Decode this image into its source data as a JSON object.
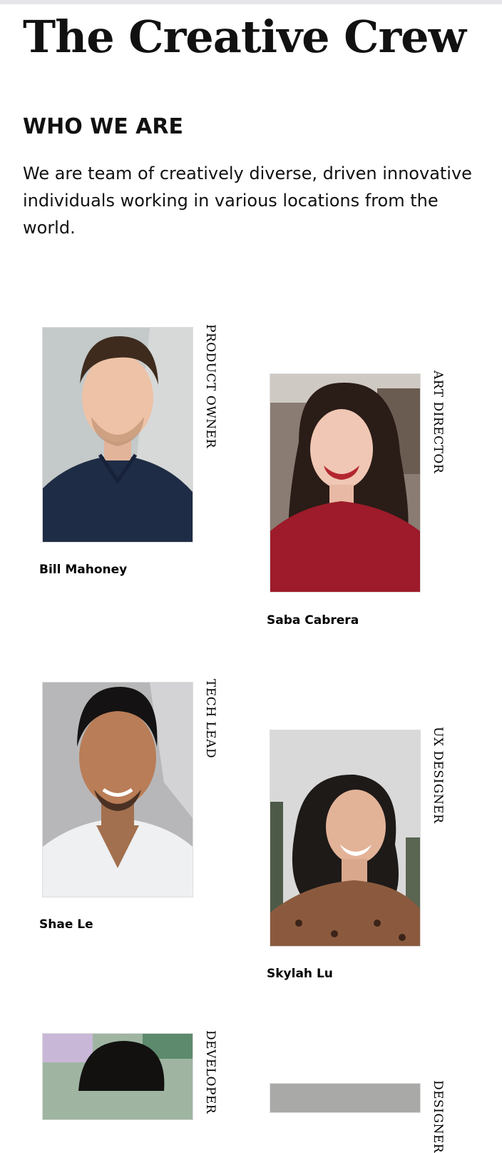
{
  "site": {
    "title": "The Creative Crew"
  },
  "about": {
    "heading": "WHO WE ARE",
    "text": "We are team of creatively diverse, driven innovative individuals working in various locations from the world."
  },
  "team": [
    {
      "name": "Bill Mahoney",
      "role": "PRODUCT OWNER",
      "photo_icon": "portrait-photo"
    },
    {
      "name": "Saba Cabrera",
      "role": "ART DIRECTOR",
      "photo_icon": "portrait-photo"
    },
    {
      "name": "Shae Le",
      "role": "TECH LEAD",
      "photo_icon": "portrait-photo"
    },
    {
      "name": "Skylah Lu",
      "role": "UX DESIGNER",
      "photo_icon": "portrait-photo"
    },
    {
      "name": "",
      "role": "DEVELOPER",
      "photo_icon": "portrait-photo"
    },
    {
      "name": "",
      "role": "DESIGNER",
      "photo_icon": "portrait-photo"
    }
  ]
}
